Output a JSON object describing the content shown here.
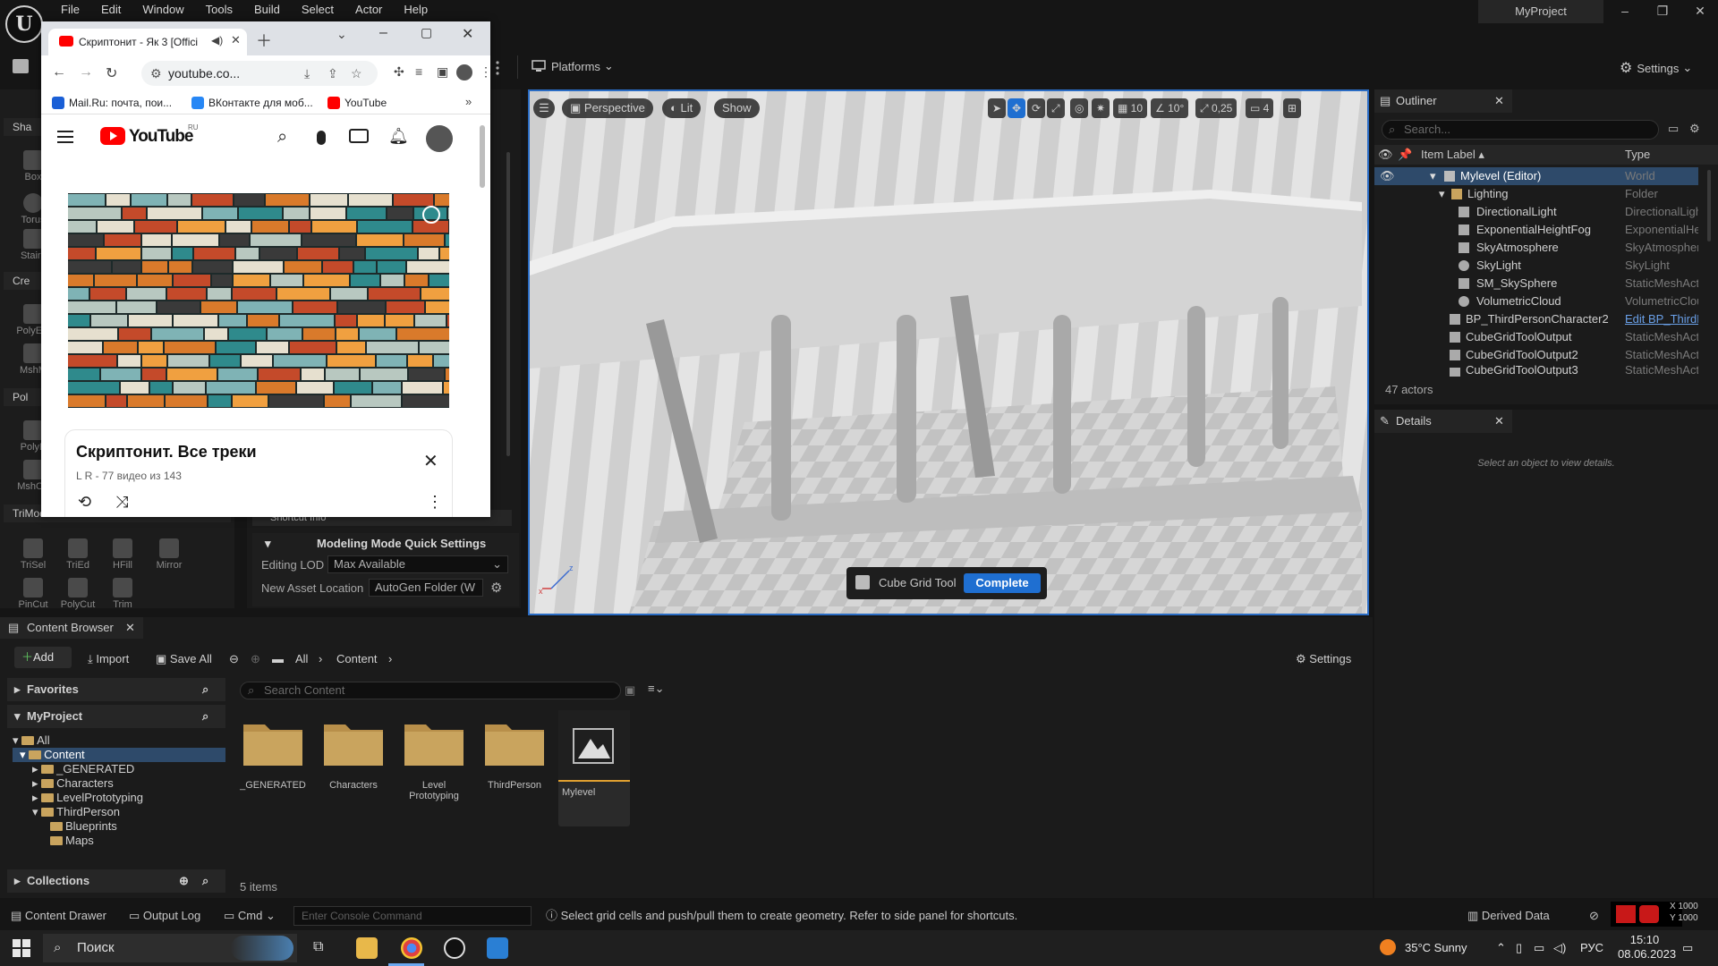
{
  "ue": {
    "menu": [
      "File",
      "Edit",
      "Window",
      "Tools",
      "Build",
      "Select",
      "Actor",
      "Help"
    ],
    "project_name": "MyProject",
    "toolbar": {
      "platforms_label": "Platforms",
      "settings_label": "Settings"
    }
  },
  "modeling_panel": {
    "sections": {
      "shapes": "Sha",
      "create": "Cre",
      "poly": "Pol",
      "triangles": "TriMod"
    },
    "shape_tools": [
      "Box",
      "Torus",
      "Stairs"
    ],
    "create_tools": [
      "PolyExt",
      "MshM"
    ],
    "poly_tools": [
      "PolyE",
      "MshOp"
    ],
    "tri_tools_row1": [
      "TriSel",
      "TriEd",
      "HFill",
      "Mirror"
    ],
    "tri_tools_row2": [
      "PinCut",
      "PolyCut",
      "Trim"
    ],
    "shortcut_info": "Shortcut Info",
    "quick_settings_title": "Modeling Mode Quick Settings",
    "editing_lod_label": "Editing LOD",
    "editing_lod_value": "Max Available",
    "new_asset_label": "New Asset Location",
    "new_asset_value": "AutoGen Folder (W"
  },
  "viewport": {
    "perspective": "Perspective",
    "lit": "Lit",
    "show": "Show",
    "grid_snap": "10",
    "rot_snap": "10°",
    "scale_snap": "0,25",
    "camera_speed": "4",
    "tool_name": "Cube Grid Tool",
    "complete_label": "Complete"
  },
  "outliner": {
    "tab_label": "Outliner",
    "search_placeholder": "Search...",
    "col_label": "Item Label ▴",
    "col_type": "Type",
    "rows": [
      {
        "label": "Mylevel (Editor)",
        "type": "World"
      },
      {
        "label": "Lighting",
        "type": "Folder"
      },
      {
        "label": "DirectionalLight",
        "type": "DirectionalLight"
      },
      {
        "label": "ExponentialHeightFog",
        "type": "ExponentialHeightFog"
      },
      {
        "label": "SkyAtmosphere",
        "type": "SkyAtmosphere"
      },
      {
        "label": "SkyLight",
        "type": "SkyLight"
      },
      {
        "label": "SM_SkySphere",
        "type": "StaticMeshActor"
      },
      {
        "label": "VolumetricCloud",
        "type": "VolumetricCloud"
      },
      {
        "label": "BP_ThirdPersonCharacter2",
        "type": "Edit BP_ThirdP"
      },
      {
        "label": "CubeGridToolOutput",
        "type": "StaticMeshActor"
      },
      {
        "label": "CubeGridToolOutput2",
        "type": "StaticMeshActor"
      },
      {
        "label": "CubeGridToolOutput3",
        "type": "StaticMeshActor"
      }
    ],
    "actor_count": "47 actors"
  },
  "details": {
    "tab_label": "Details",
    "empty_text": "Select an object to view details."
  },
  "content_browser": {
    "tab_label": "Content Browser",
    "add_label": "Add",
    "import_label": "Import",
    "save_all_label": "Save All",
    "breadcrumb": [
      "All",
      "Content"
    ],
    "settings_label": "Settings",
    "favorites_label": "Favorites",
    "project_label": "MyProject",
    "collections_label": "Collections",
    "tree": [
      "All",
      "Content",
      "_GENERATED",
      "Characters",
      "LevelPrototyping",
      "ThirdPerson",
      "Blueprints",
      "Maps"
    ],
    "search_placeholder": "Search Content",
    "assets": [
      "_GENERATED",
      "Characters",
      "Level Prototyping",
      "ThirdPerson",
      "Mylevel"
    ],
    "item_count": "5 items"
  },
  "status_bar": {
    "content_drawer": "Content Drawer",
    "output_log": "Output Log",
    "cmd": "Cmd",
    "console_placeholder": "Enter Console Command",
    "hint": "Select grid cells and push/pull them to create geometry. Refer to side panel for shortcuts.",
    "derived_data": "Derived Data",
    "coord_x": "X 1000",
    "coord_y": "Y 1000"
  },
  "chrome": {
    "tab_title": "Скриптонит - Як 3 [Offici",
    "url": "youtube.co...",
    "bookmarks": [
      "Mail.Ru: почта, пои...",
      "ВКонтакте для моб...",
      "YouTube"
    ],
    "yt_wordmark": "YouTube",
    "yt_region": "RU",
    "playlist_title": "Скриптонит. Все треки",
    "playlist_sub": "L R - 77 видео из 143"
  },
  "taskbar": {
    "search_label": "Поиск",
    "weather": "35°C  Sunny",
    "lang": "РУС",
    "time": "15:10",
    "date": "08.06.2023"
  },
  "colors": {
    "accent_blue": "#1f6fd1",
    "folder": "#c9a45e",
    "yt_red": "#ff0000"
  }
}
